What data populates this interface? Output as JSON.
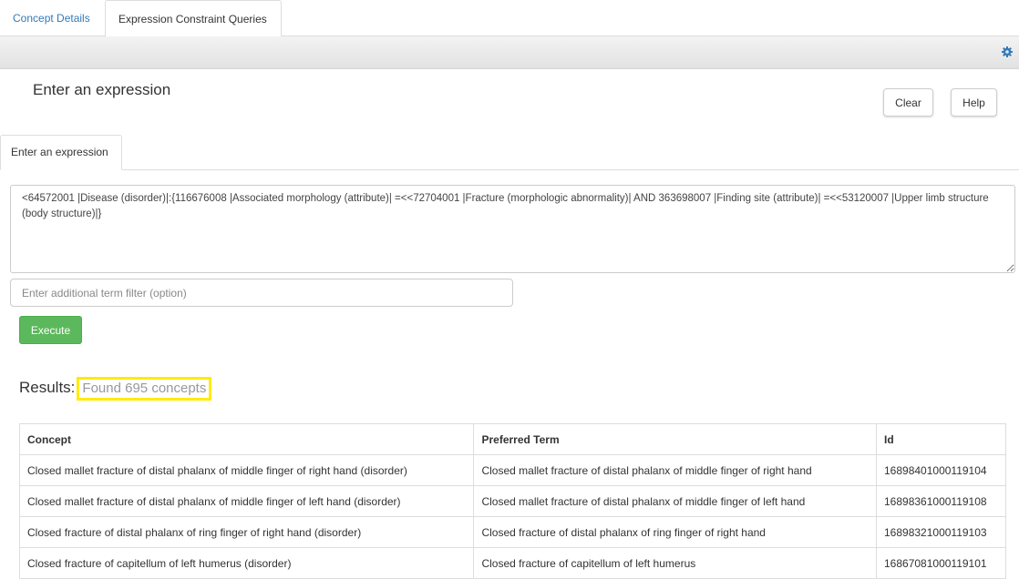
{
  "top_tabs": {
    "concept_details": "Concept Details",
    "ecl": "Expression Constraint Queries"
  },
  "title": "Enter an expression",
  "buttons": {
    "clear": "Clear",
    "help": "Help",
    "execute": "Execute"
  },
  "sub_tab": "Enter an expression",
  "expression": "<64572001 |Disease (disorder)|:{116676008 |Associated morphology (attribute)| =<<72704001 |Fracture (morphologic abnormality)| AND 363698007 |Finding site (attribute)| =<<53120007 |Upper limb structure (body structure)|}",
  "filter": {
    "placeholder": "Enter additional term filter (option)",
    "value": ""
  },
  "results": {
    "label": "Results:",
    "found": "Found 695 concepts"
  },
  "table": {
    "headers": {
      "concept": "Concept",
      "preferred": "Preferred Term",
      "id": "Id"
    },
    "rows": [
      {
        "concept": "Closed mallet fracture of distal phalanx of middle finger of right hand (disorder)",
        "preferred": "Closed mallet fracture of distal phalanx of middle finger of right hand",
        "id": "16898401000119104"
      },
      {
        "concept": "Closed mallet fracture of distal phalanx of middle finger of left hand (disorder)",
        "preferred": "Closed mallet fracture of distal phalanx of middle finger of left hand",
        "id": "16898361000119108"
      },
      {
        "concept": "Closed fracture of distal phalanx of ring finger of right hand (disorder)",
        "preferred": "Closed fracture of distal phalanx of ring finger of right hand",
        "id": "16898321000119103"
      },
      {
        "concept": "Closed fracture of capitellum of left humerus (disorder)",
        "preferred": "Closed fracture of capitellum of left humerus",
        "id": "16867081000119101"
      }
    ]
  },
  "colors": {
    "link": "#337ab7",
    "execute": "#5cb85c",
    "highlight": "#ffeb00"
  },
  "icons": {
    "settings": "gear-icon"
  }
}
